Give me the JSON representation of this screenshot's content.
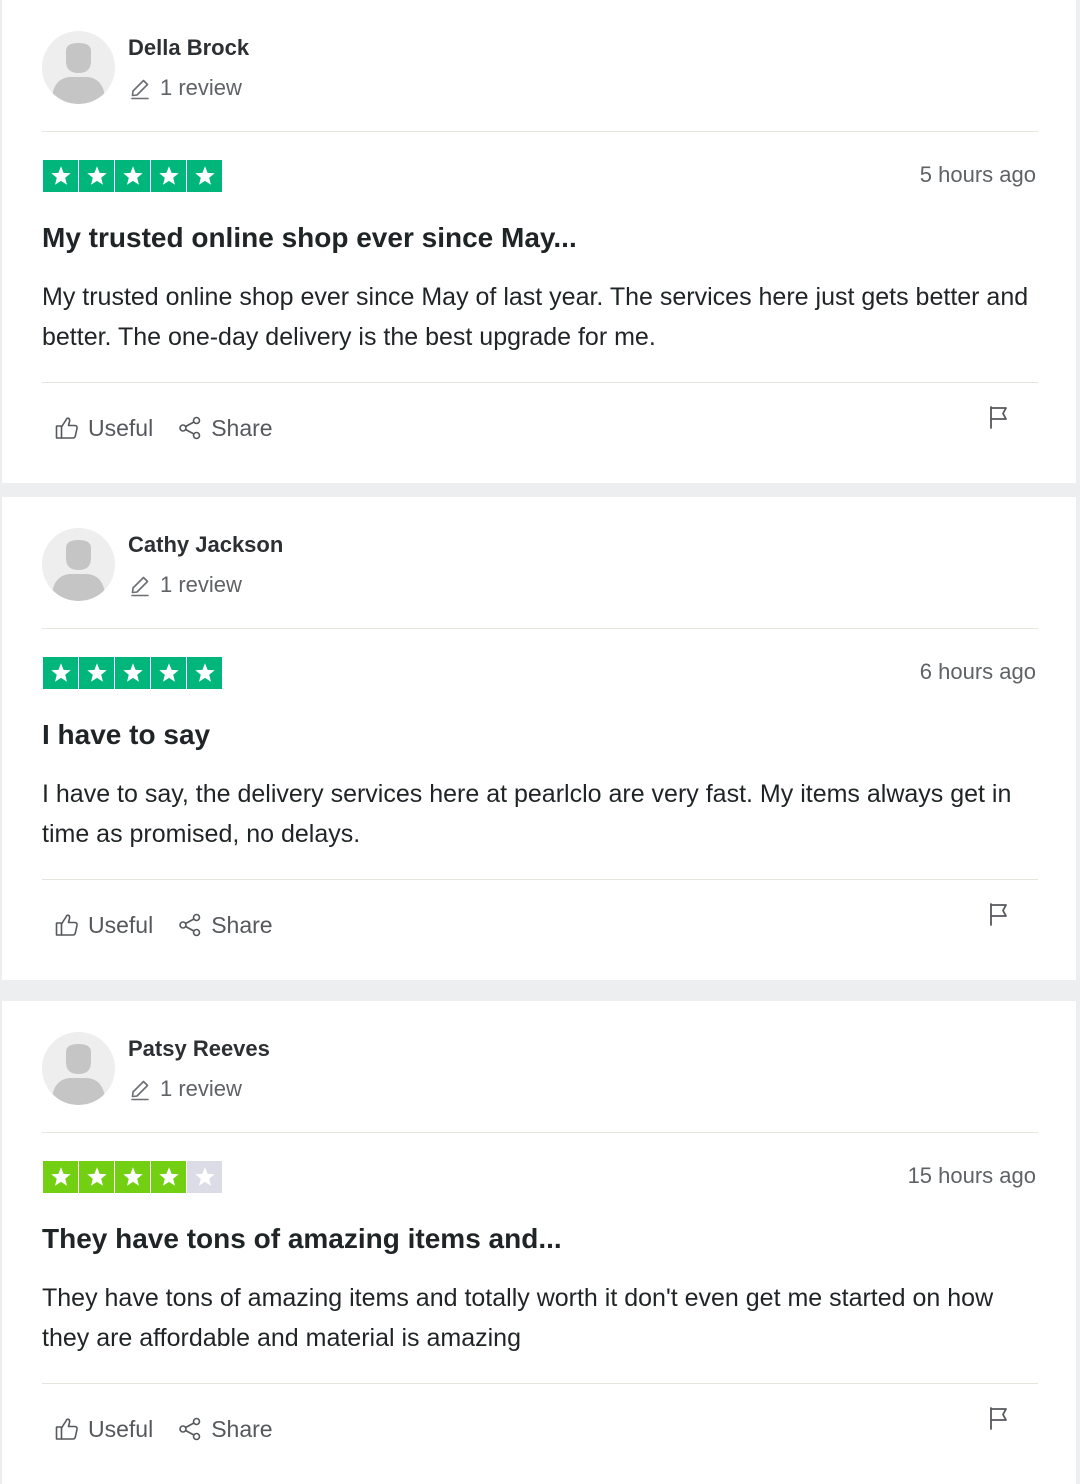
{
  "colors": {
    "star_green": "#00b67a",
    "star_lightgreen": "#73cf11",
    "star_empty": "#dcdce6",
    "page_bg": "#edeef0",
    "card_bg": "#ffffff",
    "divider": "#e5e5dd"
  },
  "actions": {
    "useful_label": "Useful",
    "share_label": "Share"
  },
  "icons": {
    "avatar": "user-silhouette-icon",
    "review_count": "pencil-icon",
    "useful": "thumbs-up-icon",
    "share": "share-icon",
    "report": "flag-icon",
    "rating": "star-icon"
  },
  "reviews": [
    {
      "name": "Della Brock",
      "review_count": "1 review",
      "rating": 5,
      "date": "5 hours ago",
      "title": "My trusted online shop ever since May...",
      "body": "My trusted online shop ever since May of last year. The services here just gets better and better. The one-day delivery is the best upgrade for me."
    },
    {
      "name": "Cathy Jackson",
      "review_count": "1 review",
      "rating": 5,
      "date": "6 hours ago",
      "title": "I have to say",
      "body": "I have to say, the delivery services here at pearlclo are very fast. My items always get in time as promised, no delays."
    },
    {
      "name": "Patsy Reeves",
      "review_count": "1 review",
      "rating": 4,
      "date": "15 hours ago",
      "title": "They have tons of amazing items and...",
      "body": "They have tons of amazing items and totally worth it don't even get me started on how they are affordable and material is amazing"
    }
  ]
}
